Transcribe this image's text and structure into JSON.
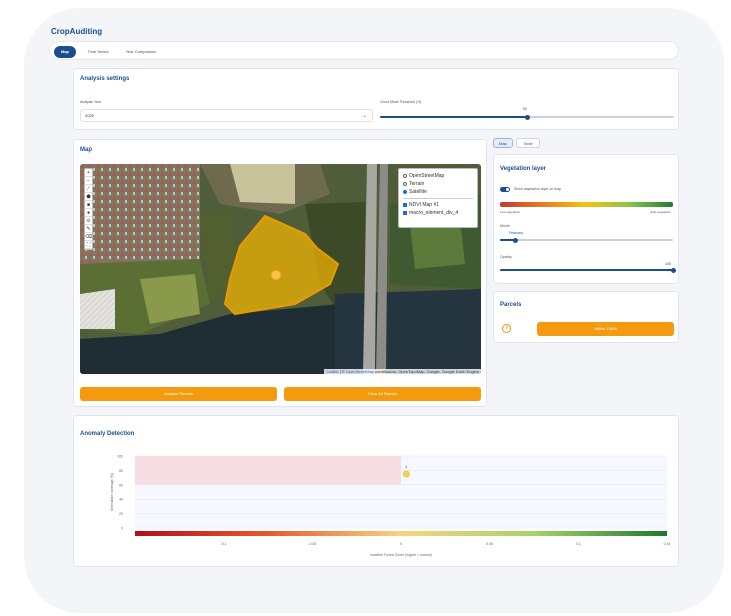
{
  "app": {
    "title": "CropAuditing"
  },
  "tabs": [
    {
      "label": "Map",
      "active": true
    },
    {
      "label": "Time Series",
      "active": false
    },
    {
      "label": "Year Comparison",
      "active": false
    }
  ],
  "analysis_settings": {
    "title": "Analysis settings",
    "year_label": "Analysis Year",
    "year_value": "2025",
    "cloud_label": "Cloud Mask Threshold (%)",
    "cloud_value": "50",
    "cloud_fraction": 0.5
  },
  "map": {
    "title": "Map",
    "layers": {
      "base": [
        {
          "label": "OpenStreetMap",
          "selected": false
        },
        {
          "label": "Terrain",
          "selected": false
        },
        {
          "label": "Satellite",
          "selected": true
        }
      ],
      "overlays": [
        {
          "label": "NDVI Map #1",
          "checked": true
        },
        {
          "label": "macro_element_div_4",
          "checked": true
        }
      ]
    },
    "attribution": {
      "leaflet": "Leaflet",
      "mid": " | © ",
      "osm": "OpenStreetMap",
      "rest": " contributors, OpenTopoMap, Google, Google Earth Engine"
    },
    "analyze_button": "Analyze Parcels",
    "clear_button": "Clear All Parcels"
  },
  "view_switch": [
    {
      "label": "Map",
      "active": true
    },
    {
      "label": "Table",
      "active": false
    }
  ],
  "vegetation_layer": {
    "title": "Vegetation layer",
    "toggle_label": "Show vegetation layer on map",
    "toggle_on": true,
    "low_label": "Low vegetation",
    "high_label": "High vegetation",
    "month_label": "Month",
    "month_value": "February",
    "month_fraction": 0.09,
    "opacity_label": "Opacity",
    "opacity_value": "100",
    "opacity_fraction": 1.0
  },
  "parcels": {
    "title": "Parcels",
    "info_icon": "info-icon",
    "button_label": "Within 100%"
  },
  "anomaly": {
    "title": "Anomaly Detection"
  },
  "chart_data": {
    "type": "scatter",
    "title": "",
    "xlabel": "Isolation Forest Score (higher = normal)",
    "ylabel": "Selectable coverage (%)",
    "xlim": [
      -0.15,
      0.15
    ],
    "ylim": [
      0,
      100
    ],
    "xticks": [
      "-0.1",
      "-0.05",
      "0",
      "0.05",
      "0.1",
      "0.15"
    ],
    "yticks": [
      "100",
      "80",
      "60",
      "40",
      "20",
      "0"
    ],
    "anomaly_region": {
      "x": [
        -0.15,
        0.0
      ],
      "y": [
        60,
        100
      ]
    },
    "points": [
      {
        "x": 0.003,
        "y": 75,
        "label": "1"
      }
    ],
    "colorscale": [
      "#b10e1c",
      "#e85a2a",
      "#f5d57c",
      "#a7d36a",
      "#1a7a2c"
    ]
  },
  "colors": {
    "accent": "#1c4e8f",
    "button": "#f39a0e",
    "parcel_fill": "#f4b400"
  }
}
